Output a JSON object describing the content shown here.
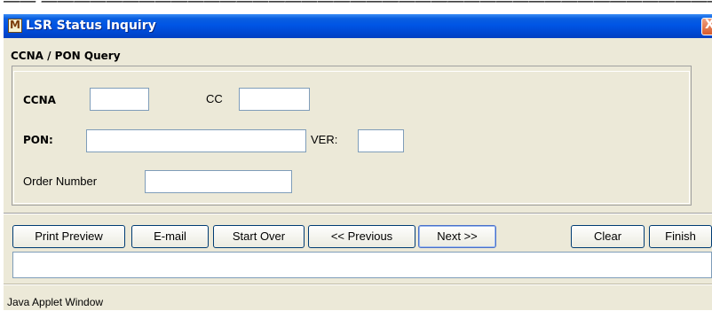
{
  "window": {
    "title": "LSR Status Inquiry",
    "icon_glyph": "M",
    "close_glyph": "X"
  },
  "section": {
    "title": "CCNA / PON Query"
  },
  "form": {
    "ccna_label": "CCNA",
    "ccna_value": "",
    "cc_label": "CC",
    "cc_value": "",
    "pon_label": "PON:",
    "pon_value": "",
    "ver_label": "VER:",
    "ver_value": "",
    "order_number_label": "Order Number",
    "order_number_value": ""
  },
  "buttons": {
    "print_preview": "Print Preview",
    "email": "E-mail",
    "start_over": "Start Over",
    "previous": "<< Previous",
    "next": "Next >>",
    "clear": "Clear",
    "finish": "Finish"
  },
  "status": {
    "message": ""
  },
  "footer": {
    "applet_label": "Java Applet Window"
  },
  "colors": {
    "titlebar": "#0055e5",
    "window_bg": "#ece9d8",
    "button_border": "#003c74",
    "input_border": "#7f9db9",
    "close_button": "#d85a2a"
  },
  "icons": [
    "app-icon",
    "close-icon"
  ]
}
